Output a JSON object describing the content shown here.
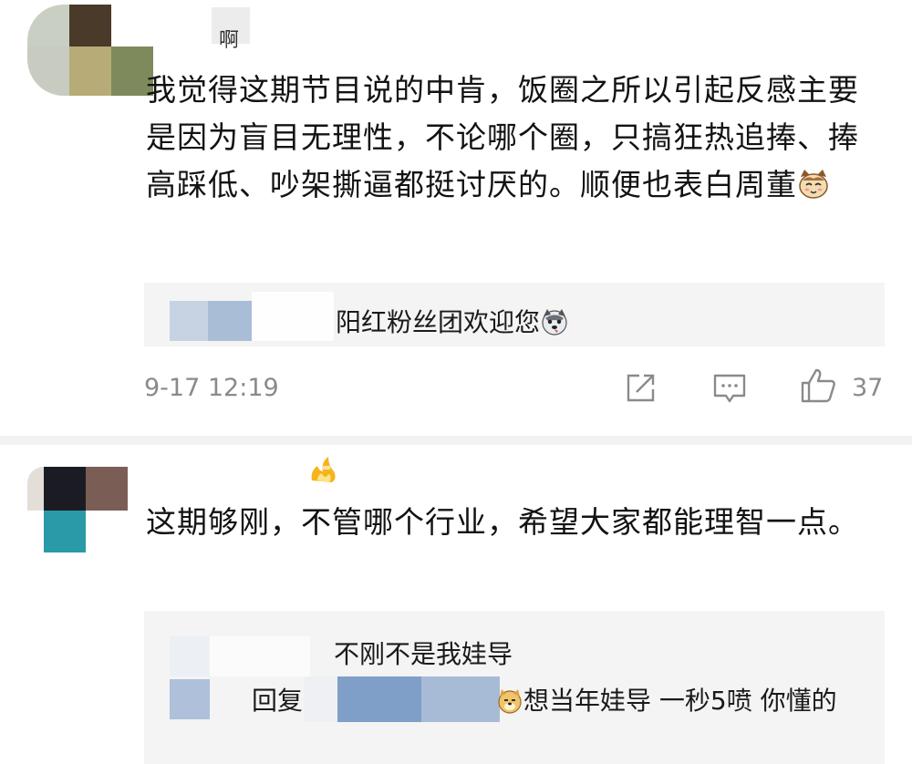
{
  "comments": [
    {
      "username": "啊",
      "text": "我觉得这期节目说的中肯，饭圈之所以引起反感主要是因为盲目无理性，不论哪个圈，只搞狂热追捧、捧高踩低、吵架撕逼都挺讨厌的。顺便也表白周董",
      "emoji": "cat-face-emoji",
      "fan_tag": "阳红粉丝团欢迎您",
      "fan_tag_emoji": "husky-dog-emoji",
      "timestamp": "9-17 12:19",
      "likes": "37",
      "icons": [
        "share-icon",
        "comment-icon",
        "thumbs-up-icon"
      ]
    },
    {
      "username_badge": "fire-badge-icon",
      "text": "这期够刚，不管哪个行业，希望大家都能理智一点。",
      "replies": [
        {
          "text": "不刚不是我娃导"
        },
        {
          "prefix": "回复",
          "text": "想当年娃导 一秒5喷 你懂的",
          "emoji": "doge-emoji"
        }
      ]
    }
  ],
  "colors": {
    "background": "#ffffff",
    "reply_bg": "#f4f4f4",
    "meta_text": "#8a8a8a",
    "divider": "#f2f2f2"
  }
}
